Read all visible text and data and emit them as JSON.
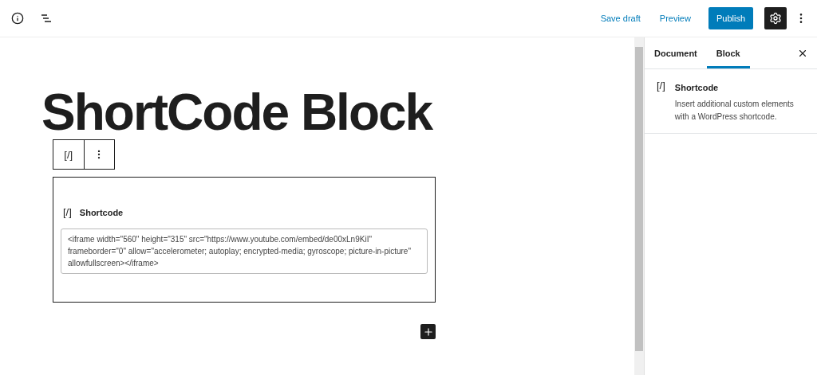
{
  "header": {
    "save_draft": "Save draft",
    "preview": "Preview",
    "publish": "Publish",
    "settings_active": true
  },
  "editor": {
    "title": "ShortCode Block",
    "toolbar": {
      "block_glyph": "[/]"
    },
    "block": {
      "glyph": "[/]",
      "label": "Shortcode",
      "value": "<iframe width=\"560\" height=\"315\" src=\"https://www.youtube.com/embed/de00xLn9KiI\" frameborder=\"0\" allow=\"accelerometer; autoplay; encrypted-media; gyroscope; picture-in-picture\" allowfullscreen></iframe>"
    }
  },
  "sidebar": {
    "tabs": [
      {
        "label": "Document",
        "selected": false
      },
      {
        "label": "Block",
        "selected": true
      }
    ],
    "block_info": {
      "glyph": "[/]",
      "name": "Shortcode",
      "description": "Insert additional custom elements with a WordPress shortcode."
    }
  }
}
